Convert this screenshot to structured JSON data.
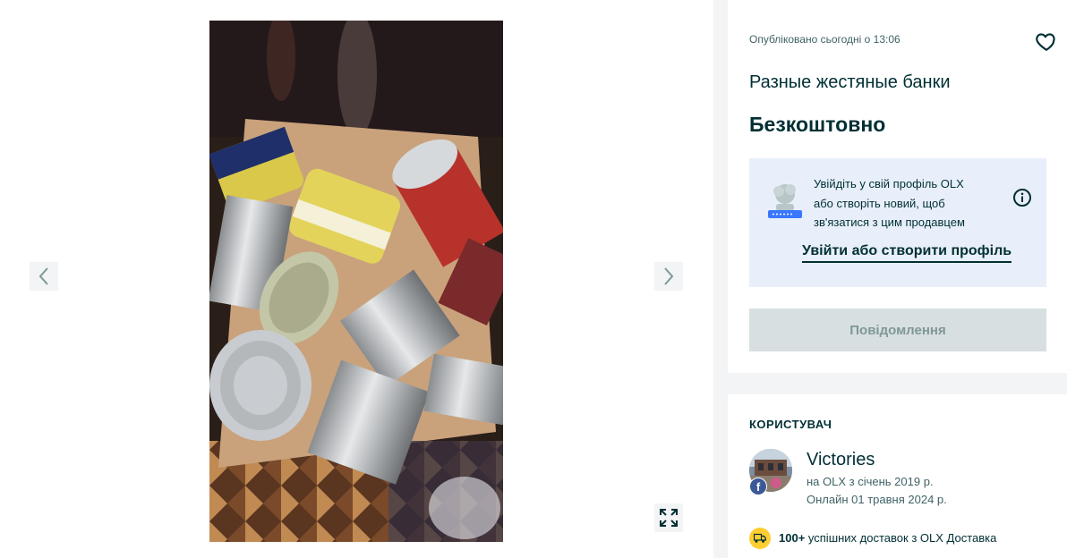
{
  "gallery": {
    "prev_icon": "chevron-left-icon",
    "next_icon": "chevron-right-icon",
    "fullscreen_icon": "expand-icon"
  },
  "ad": {
    "published": "Опубліковано сьогодні о 13:06",
    "title": "Разные жестяные банки",
    "price": "Безкоштовно",
    "favorite_icon": "heart-icon"
  },
  "login_prompt": {
    "line1": "Увійдіть у свій профіль OLX",
    "line2": "або створіть новий, щоб",
    "line3": "зв'язатися з цим продавцем",
    "link": "Увійти або створити профіль"
  },
  "message_button": "Повідомлення",
  "user": {
    "heading": "КОРИСТУВАЧ",
    "name": "Victories",
    "since": "на OLX з січень 2019 р.",
    "online": "Онлайн 01 травня 2024 р.",
    "badge": "f",
    "delivery_count": "100+",
    "delivery_text": " успішних доставок з OLX Доставка"
  },
  "colors": {
    "primary": "#002f34",
    "login_bg": "#e8effa",
    "button_disabled": "#d8dfe0",
    "delivery_badge": "#ffce32"
  }
}
